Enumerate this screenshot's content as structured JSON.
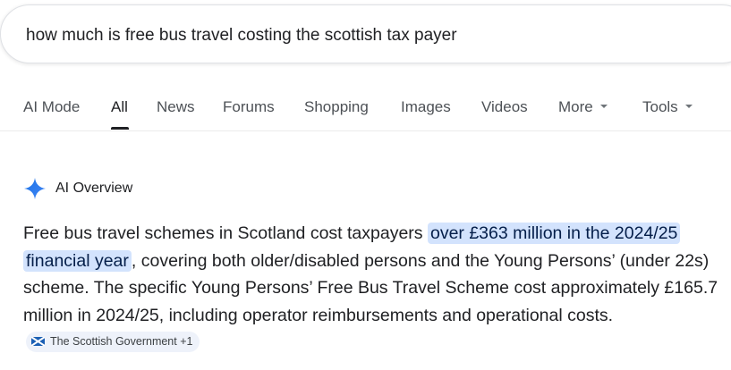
{
  "search": {
    "query": "how much is free bus travel costing the scottish tax payer"
  },
  "tabs": [
    {
      "label": "AI Mode"
    },
    {
      "label": "All"
    },
    {
      "label": "News"
    },
    {
      "label": "Forums"
    },
    {
      "label": "Shopping"
    },
    {
      "label": "Images"
    },
    {
      "label": "Videos"
    },
    {
      "label": "More"
    },
    {
      "label": "Tools"
    }
  ],
  "active_tab": "All",
  "ai_overview": {
    "title": "AI Overview",
    "text_before": "Free bus travel schemes in Scotland cost taxpayers ",
    "highlight": "over £363 million in the 2024/25 financial year",
    "text_after": ", covering both older/disabled persons and the Young Persons’ (under 22s) scheme. The specific Young Persons’ Free Bus Travel Scheme cost approximately £165.7 million in 2024/25, including operator reimbursements and operational costs.",
    "source": {
      "label": "The Scottish Government +1",
      "icon": "scotland-flag-icon"
    }
  },
  "colors": {
    "highlight_bg": "#d3e3fd",
    "chip_bg": "#eef2fa",
    "spark_blue": "#4285f4"
  }
}
